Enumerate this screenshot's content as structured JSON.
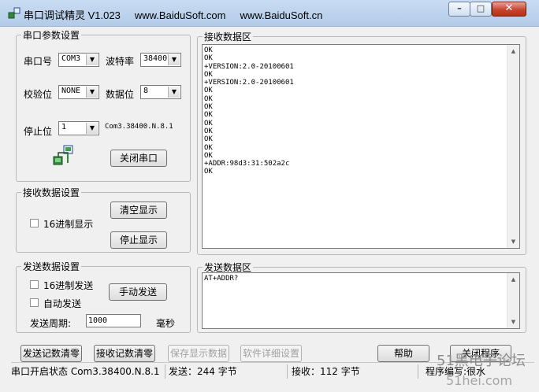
{
  "window": {
    "title": "串口调试精灵 V1.023     www.BaiduSoft.com     www.BaiduSoft.cn"
  },
  "serial_settings": {
    "legend": "串口参数设置",
    "port_label": "串口号",
    "port_value": "COM3",
    "baud_label": "波特率",
    "baud_value": "38400",
    "parity_label": "校验位",
    "parity_value": "NONE",
    "databits_label": "数据位",
    "databits_value": "8",
    "stopbits_label": "停止位",
    "stopbits_value": "1",
    "config_text": "Com3.38400.N.8.1",
    "close_port_label": "关闭串口"
  },
  "receive_settings": {
    "legend": "接收数据设置",
    "hex_display_label": "16进制显示",
    "clear_display_label": "清空显示",
    "stop_display_label": "停止显示"
  },
  "send_settings": {
    "legend": "发送数据设置",
    "hex_send_label": "16进制发送",
    "auto_send_label": "自动发送",
    "manual_send_label": "手动发送",
    "period_label": "发送周期:",
    "period_value": "1000",
    "period_unit": "毫秒"
  },
  "receive_area": {
    "legend": "接收数据区",
    "lines": [
      "OK",
      "OK",
      "+VERSION:2.0-20100601",
      "OK",
      "+VERSION:2.0-20100601",
      "OK",
      "OK",
      "OK",
      "OK",
      "OK",
      "OK",
      "OK",
      "OK",
      "OK",
      "+ADDR:98d3:31:502a2c",
      "OK"
    ]
  },
  "send_area": {
    "legend": "发送数据区",
    "text": "AT+ADDR?"
  },
  "bottom_buttons": {
    "clear_send_count": "发送记数清零",
    "clear_recv_count": "接收记数清零",
    "save_display": "保存显示数据",
    "software_details": "软件详细设置",
    "help": "帮助",
    "close_program": "关闭程序"
  },
  "status": {
    "port_state": "串口开启状态  Com3.38400.N.8.1",
    "sent": "发送：244 字节",
    "received": "接收：112 字节",
    "author": "程序编写:很水"
  },
  "watermark": {
    "line1": "51黑电子论坛",
    "line2": "51hei.com"
  }
}
